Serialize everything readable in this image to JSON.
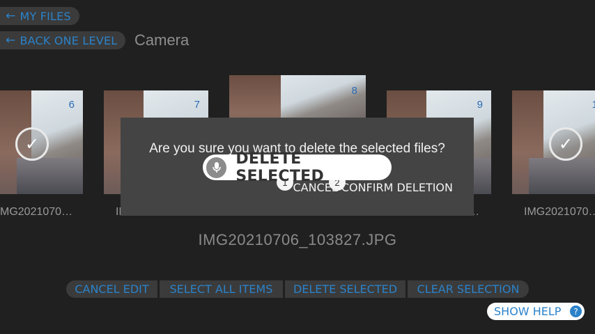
{
  "nav": {
    "my_files": "MY FILES",
    "back_one_level": "BACK ONE LEVEL",
    "folder": "Camera"
  },
  "gallery": {
    "items": [
      {
        "number": "6",
        "caption": "MG2021070…",
        "selected": true
      },
      {
        "number": "7",
        "caption": "IM",
        "selected": false
      },
      {
        "number": "8",
        "caption": "",
        "selected": false
      },
      {
        "number": "9",
        "caption": "…",
        "selected": false
      },
      {
        "number": "1",
        "caption": "IMG2021070…",
        "selected": true
      }
    ],
    "current_file": "IMG20210706_103827.JPG"
  },
  "toolbar": {
    "cancel_edit": "CANCEL EDIT",
    "select_all": "SELECT ALL ITEMS",
    "delete_selected": "DELETE SELECTED",
    "clear_selection": "CLEAR SELECTION"
  },
  "help": {
    "label": "SHOW HELP",
    "icon_text": "?"
  },
  "dialog": {
    "message": "Are you sure you want to delete the selected files?",
    "actions_text": "CANCEL CONFIRM DELETION",
    "badge_1": "1",
    "badge_2": "2"
  },
  "voice": {
    "command": "DELETE SELECTED"
  },
  "icons": {
    "back": "arrow-left-icon",
    "check": "check-icon",
    "mic": "microphone-icon",
    "help": "question-icon"
  },
  "colors": {
    "accent": "#2b82c9",
    "background": "#202020",
    "dialog": "#444444"
  }
}
